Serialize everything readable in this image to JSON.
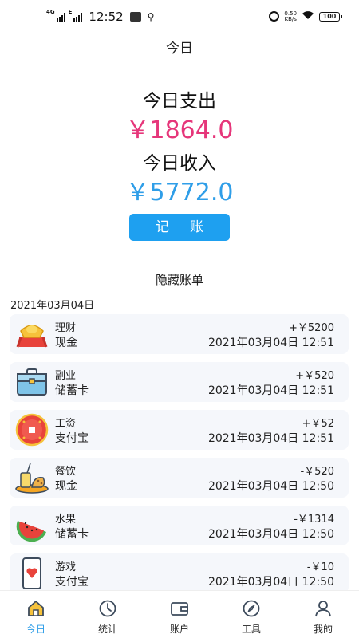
{
  "status_bar": {
    "net1": "4G",
    "net2": "E",
    "time": "12:52",
    "net_speed_value": "0.50",
    "net_speed_unit": "KB/s",
    "battery": "100"
  },
  "page_title": "今日",
  "summary": {
    "expense_label": "今日支出",
    "expense_amount": "￥1864.0",
    "income_label": "今日收入",
    "income_amount": "￥5772.0"
  },
  "record_button": "记账",
  "hidden_bills": "隐藏账单",
  "date_header": "2021年03月04日",
  "transactions": [
    {
      "category": "理财",
      "account": "现金",
      "amount": "+￥5200",
      "time": "2021年03月04日 12:51",
      "icon": "gold-ingot-icon"
    },
    {
      "category": "副业",
      "account": "储蓄卡",
      "amount": "+￥520",
      "time": "2021年03月04日 12:51",
      "icon": "toolbox-icon"
    },
    {
      "category": "工资",
      "account": "支付宝",
      "amount": "+￥52",
      "time": "2021年03月04日 12:51",
      "icon": "red-coin-icon"
    },
    {
      "category": "餐饮",
      "account": "现金",
      "amount": "-￥520",
      "time": "2021年03月04日 12:50",
      "icon": "food-icon"
    },
    {
      "category": "水果",
      "account": "储蓄卡",
      "amount": "-￥1314",
      "time": "2021年03月04日 12:50",
      "icon": "watermelon-icon"
    },
    {
      "category": "游戏",
      "account": "支付宝",
      "amount": "-￥10",
      "time": "2021年03月04日 12:50",
      "icon": "playing-card-icon"
    }
  ],
  "nav": [
    {
      "label": "今日",
      "icon": "home-icon",
      "active": true
    },
    {
      "label": "统计",
      "icon": "clock-icon",
      "active": false
    },
    {
      "label": "账户",
      "icon": "wallet-icon",
      "active": false
    },
    {
      "label": "工具",
      "icon": "compass-icon",
      "active": false
    },
    {
      "label": "我的",
      "icon": "user-icon",
      "active": false
    }
  ],
  "colors": {
    "accent": "#2f9ee8",
    "expense": "#e6367a",
    "button": "#1ea0f0",
    "item_bg": "#f5f7fb"
  }
}
